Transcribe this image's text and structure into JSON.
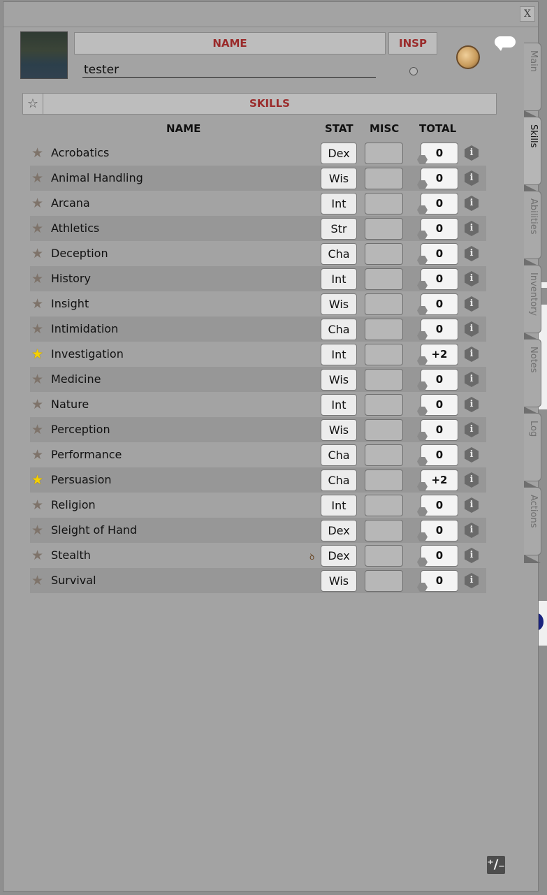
{
  "window": {
    "close_label": "X"
  },
  "header": {
    "name_label": "NAME",
    "insp_label": "INSP",
    "name_value": "tester"
  },
  "skills_section": {
    "title": "SKILLS",
    "columns": {
      "name": "NAME",
      "stat": "STAT",
      "misc": "MISC",
      "total": "TOTAL"
    }
  },
  "skills": [
    {
      "name": "Acrobatics",
      "stat": "Dex",
      "misc": "",
      "total": "0",
      "proficient": false
    },
    {
      "name": "Animal Handling",
      "stat": "Wis",
      "misc": "",
      "total": "0",
      "proficient": false
    },
    {
      "name": "Arcana",
      "stat": "Int",
      "misc": "",
      "total": "0",
      "proficient": false
    },
    {
      "name": "Athletics",
      "stat": "Str",
      "misc": "",
      "total": "0",
      "proficient": false
    },
    {
      "name": "Deception",
      "stat": "Cha",
      "misc": "",
      "total": "0",
      "proficient": false
    },
    {
      "name": "History",
      "stat": "Int",
      "misc": "",
      "total": "0",
      "proficient": false
    },
    {
      "name": "Insight",
      "stat": "Wis",
      "misc": "",
      "total": "0",
      "proficient": false
    },
    {
      "name": "Intimidation",
      "stat": "Cha",
      "misc": "",
      "total": "0",
      "proficient": false
    },
    {
      "name": "Investigation",
      "stat": "Int",
      "misc": "",
      "total": "+2",
      "proficient": true
    },
    {
      "name": "Medicine",
      "stat": "Wis",
      "misc": "",
      "total": "0",
      "proficient": false
    },
    {
      "name": "Nature",
      "stat": "Int",
      "misc": "",
      "total": "0",
      "proficient": false
    },
    {
      "name": "Perception",
      "stat": "Wis",
      "misc": "",
      "total": "0",
      "proficient": false
    },
    {
      "name": "Performance",
      "stat": "Cha",
      "misc": "",
      "total": "0",
      "proficient": false
    },
    {
      "name": "Persuasion",
      "stat": "Cha",
      "misc": "",
      "total": "+2",
      "proficient": true
    },
    {
      "name": "Religion",
      "stat": "Int",
      "misc": "",
      "total": "0",
      "proficient": false
    },
    {
      "name": "Sleight of Hand",
      "stat": "Dex",
      "misc": "",
      "total": "0",
      "proficient": false
    },
    {
      "name": "Stealth",
      "stat": "Dex",
      "misc": "",
      "total": "0",
      "proficient": false,
      "disadvantage": true
    },
    {
      "name": "Survival",
      "stat": "Wis",
      "misc": "",
      "total": "0",
      "proficient": false
    }
  ],
  "tabs": [
    {
      "label": "Main",
      "active": false
    },
    {
      "label": "Skills",
      "active": true
    },
    {
      "label": "Abilities",
      "active": false
    },
    {
      "label": "Inventory",
      "active": false
    },
    {
      "label": "Notes",
      "active": false
    },
    {
      "label": "Log",
      "active": false
    },
    {
      "label": "Actions",
      "active": false
    }
  ],
  "icons": {
    "skills_filter": "star-icon",
    "proficiency": "star-icon",
    "info": "info-icon",
    "inspiration_coin": "coin-icon",
    "chat": "chat-bubble-icon",
    "resize": "resize-icon",
    "stealth_flag": "disadvantage-icon"
  },
  "colors": {
    "header_text": "#9a2a2a",
    "proficient_star": "#f5d000",
    "panel_bg": "#a3a3a3"
  }
}
